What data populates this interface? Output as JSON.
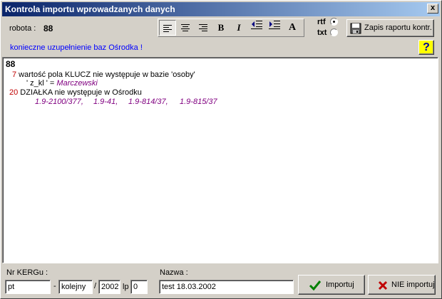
{
  "window": {
    "title": "Kontrola importu wprowadzanych danych",
    "close_label": "x"
  },
  "header": {
    "robota_label": "robota :",
    "robota_value": "88"
  },
  "toolbar": {
    "bold_label": "B",
    "italic_label": "I",
    "font_label": "A",
    "format_rtf_label": "rtf",
    "format_txt_label": "txt",
    "format_selected": "rtf",
    "save_report_label": "Zapis raportu kontr."
  },
  "info": {
    "message": "konieczne uzupełnienie baz Ośrodka !",
    "help_label": "?"
  },
  "report": {
    "heading": "88",
    "entry1": {
      "num": "7",
      "text": " wartość pola KLUCZ nie występuje w bazie 'osoby'",
      "sub_prefix": "' z_kl ' = ",
      "sub_value": "Marczewski"
    },
    "entry2": {
      "num": "20",
      "text": " DZIAŁKA nie występuje w Ośrodku",
      "items": [
        "1.9-2100/377,",
        "1.9-41,",
        "1.9-814/37,",
        "1.9-815/37"
      ]
    }
  },
  "footer": {
    "kerg_label": "Nr KERGu :",
    "kerg_part1": "pt",
    "dash": "-",
    "kerg_kolejny": "kolejny",
    "slash": "/",
    "kerg_year": "2002",
    "lp_label": "lp",
    "lp_value": "0",
    "nazwa_label": "Nazwa :",
    "nazwa_value": "test 18.03.2002",
    "import_label": "Importuj",
    "no_import_label": "NIE importuj"
  },
  "colors": {
    "title_start": "#0a246a",
    "title_end": "#a6caf0",
    "info_text": "#0000ff",
    "error_num": "#c00000",
    "value_italic": "#800080"
  }
}
